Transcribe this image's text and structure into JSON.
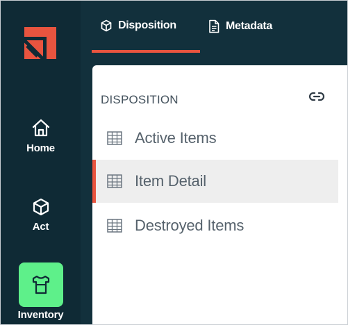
{
  "rail": {
    "logo": {
      "icon": "brand-logo-icon",
      "color": "#e8543f"
    },
    "items": [
      {
        "label": "Home",
        "icon": "home-icon"
      },
      {
        "label": "Act",
        "icon": "cube-icon"
      },
      {
        "label": "Inventory",
        "icon": "shirt-icon",
        "active": true,
        "highlight_color": "#5ef08a"
      }
    ]
  },
  "tabs": [
    {
      "label": "Disposition",
      "icon": "cube-icon",
      "active": true
    },
    {
      "label": "Metadata",
      "icon": "document-icon",
      "active": false
    }
  ],
  "panel": {
    "section_title": "DISPOSITION",
    "link_icon": "link-icon",
    "items": [
      {
        "label": "Active Items",
        "icon": "table-icon",
        "active": false
      },
      {
        "label": "Item Detail",
        "icon": "table-icon",
        "active": true
      },
      {
        "label": "Destroyed Items",
        "icon": "table-icon",
        "active": false
      }
    ]
  },
  "colors": {
    "rail_bg": "#0f2a35",
    "topbar_bg": "#12303c",
    "accent": "#e8543f",
    "inventory_green": "#5ef08a"
  }
}
